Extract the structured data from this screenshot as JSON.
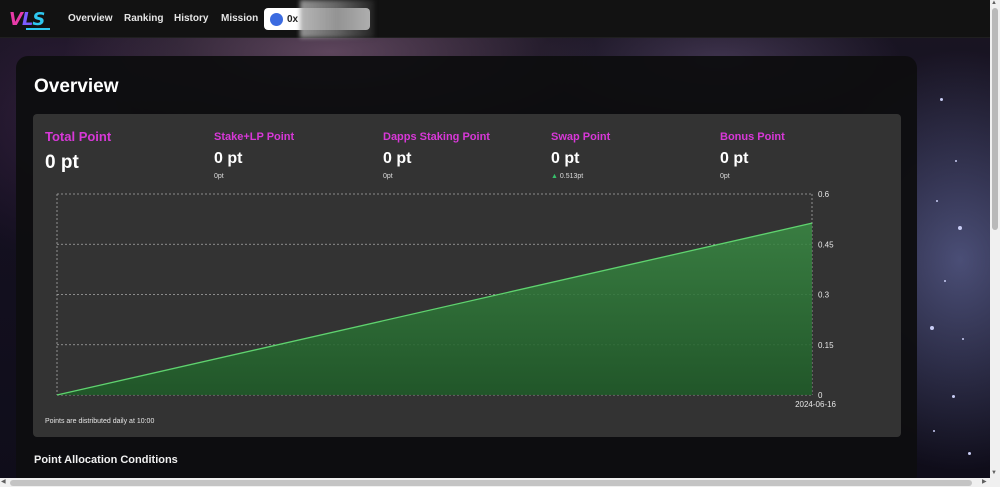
{
  "nav": {
    "links": [
      "Overview",
      "Ranking",
      "History",
      "Mission"
    ],
    "wallet_text": "0x"
  },
  "page": {
    "title": "Overview"
  },
  "stats": [
    {
      "label": "Total Point",
      "value": "0 pt",
      "sub": ""
    },
    {
      "label": "Stake+LP Point",
      "value": "0 pt",
      "sub": "0pt"
    },
    {
      "label": "Dapps Staking Point",
      "value": "0 pt",
      "sub": "0pt"
    },
    {
      "label": "Swap Point",
      "value": "0 pt",
      "sub": "0.513pt"
    },
    {
      "label": "Bonus Point",
      "value": "0 pt",
      "sub": "0pt"
    }
  ],
  "chart_data": {
    "type": "area",
    "x": [
      "",
      "2024-06-16"
    ],
    "series": [
      {
        "values": [
          0,
          0.513
        ]
      }
    ],
    "y_ticks": [
      "0",
      "0.15",
      "0.3",
      "0.45",
      "0.6"
    ],
    "ylim": [
      0,
      0.6
    ],
    "x_tick_labels": [
      "2024-06-16"
    ],
    "grid": true,
    "line_color": "#5fd36f",
    "fill_color": "#2d6a36"
  },
  "note": "Points are distributed daily at 10:00",
  "section": {
    "title": "Point Allocation Conditions"
  }
}
